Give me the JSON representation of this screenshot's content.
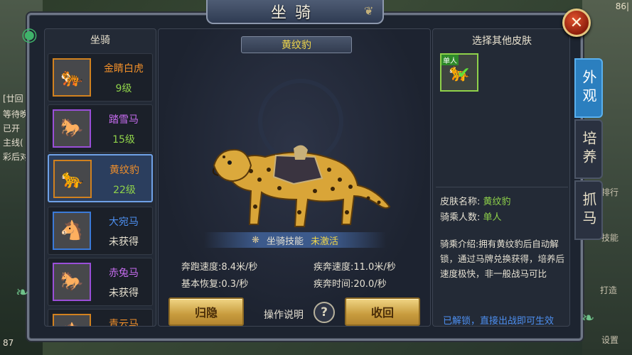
{
  "window": {
    "title": "坐骑"
  },
  "background": {
    "top_right_text": "86|",
    "left_texts": [
      "[廿回",
      "等待晚",
      "已开",
      "主线(",
      "彩后对"
    ],
    "right_texts": [
      "排行",
      "技能",
      "打造",
      "设置"
    ],
    "bottom_left_text": "87"
  },
  "list": {
    "header": "坐骑",
    "items": [
      {
        "name": "金睛白虎",
        "level": "9级",
        "icon": "tiger-icon"
      },
      {
        "name": "踏雪马",
        "level": "15级",
        "icon": "white-horse-icon"
      },
      {
        "name": "黄纹豹",
        "level": "22级",
        "icon": "leopard-icon"
      },
      {
        "name": "大宛马",
        "level": "未获得",
        "icon": "grey-horse-icon"
      },
      {
        "name": "赤兔马",
        "level": "未获得",
        "icon": "black-horse-icon"
      },
      {
        "name": "青云马",
        "level": "",
        "icon": "horse-icon"
      }
    ]
  },
  "center": {
    "mount_name": "黄纹豹",
    "skill_label": "坐骑技能",
    "skill_status": "未激活",
    "stats": {
      "run_speed": "奔跑速度:8.4米/秒",
      "sprint_speed": "疾奔速度:11.0米/秒",
      "recovery": "基本恢复:0.3/秒",
      "sprint_time": "疾奔时间:20.0/秒"
    },
    "hide_button": "归隐",
    "help_label": "操作说明",
    "help_icon": "?",
    "recall_button": "收回"
  },
  "right": {
    "header": "选择其他皮肤",
    "skin_tag": "单人",
    "skin_name_label": "皮肤名称:",
    "skin_name_value": "黄纹豹",
    "riders_label": "骑乘人数:",
    "riders_value": "单人",
    "description": "骑乘介绍:拥有黄纹豹后自动解锁，通过马牌兑换获得，培养后速度极快，非一般战马可比",
    "unlock_text": "已解锁，直接出战即可生效"
  },
  "tabs": [
    "外观",
    "培养",
    "抓马"
  ],
  "colors": {
    "accent_blue": "#2b7fbf",
    "quality_orange": "#f08f2a",
    "quality_purple": "#c76cf0",
    "quality_blue": "#4d8ff0",
    "level_green": "#8fd24a",
    "name_yellow": "#f1d74a"
  }
}
